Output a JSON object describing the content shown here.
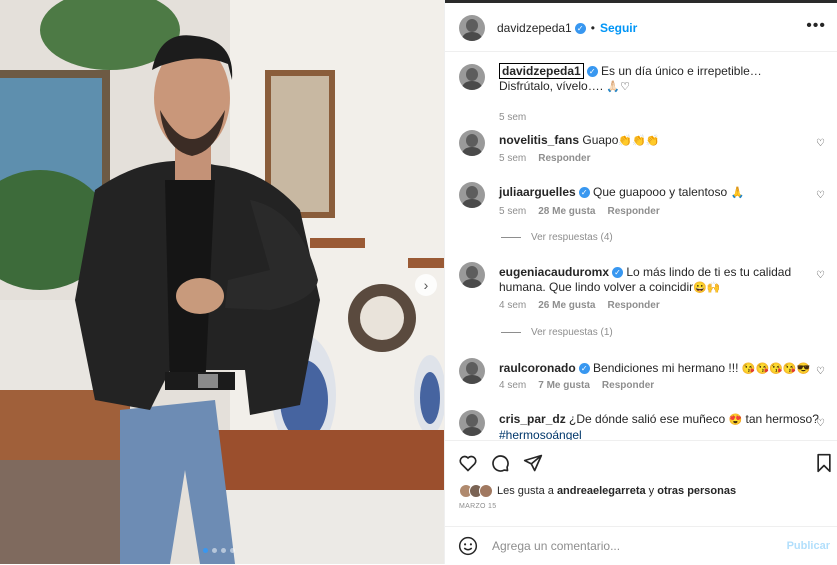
{
  "post": {
    "username": "davidzepeda1",
    "follow_label": "Seguir",
    "more_label": "•••",
    "dot": "•"
  },
  "caption": {
    "username": "davidzepeda1",
    "text_line1": "Es un día único e irrepetible…",
    "text_line2": "Disfrútalo, vívelo….",
    "emojis": "🙏🏻♡",
    "time": "5 sem"
  },
  "comments": [
    {
      "username": "novelitis_fans",
      "text": "Guapo",
      "emojis": "👏👏👏",
      "time": "5 sem",
      "likes": "",
      "reply": "Responder",
      "verified": false
    },
    {
      "username": "juliaarguelles",
      "text": "Que guapooo y talentoso",
      "emojis": "🙏",
      "time": "5 sem",
      "likes": "28 Me gusta",
      "reply": "Responder",
      "verified": true,
      "view_replies": "Ver respuestas (4)"
    },
    {
      "username": "eugeniacauduromx",
      "text": "Lo más lindo de ti es tu calidad humana. Que lindo volver a coincidir",
      "emojis": "😀🙌",
      "time": "4 sem",
      "likes": "26 Me gusta",
      "reply": "Responder",
      "verified": true,
      "view_replies": "Ver respuestas (1)"
    },
    {
      "username": "raulcoronado",
      "text": "Bendiciones mi hermano !!!",
      "emojis": "😘😘😘😘😎",
      "time": "4 sem",
      "likes": "7 Me gusta",
      "reply": "Responder",
      "verified": true
    },
    {
      "username": "cris_par_dz",
      "text": "¿De dónde salió ese muñeco",
      "emojis": "😍",
      "text_after": "tan hermoso?",
      "hashtag": "#hermosoángel",
      "verified": false
    }
  ],
  "likes": {
    "prefix": "Les gusta a",
    "user": "andreaelegarreta",
    "middle": "y",
    "others": "otras personas"
  },
  "date": "MARZO 15",
  "add_comment": {
    "placeholder": "Agrega un comentario...",
    "post_label": "Publicar"
  },
  "colors": {
    "accent": "#0095f6",
    "verified": "#3897f0",
    "muted": "#8e8e8e"
  }
}
